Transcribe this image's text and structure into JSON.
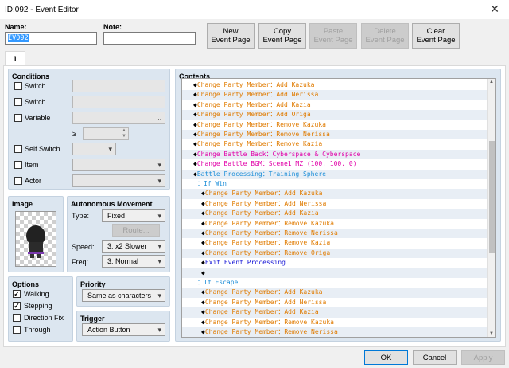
{
  "window": {
    "title": "ID:092 - Event Editor",
    "close_glyph": "✕"
  },
  "header": {
    "name_label": "Name:",
    "name_value": "EV092",
    "note_label": "Note:",
    "note_value": "",
    "buttons": {
      "new": "New\nEvent Page",
      "copy": "Copy\nEvent Page",
      "paste": "Paste\nEvent Page",
      "delete": "Delete\nEvent Page",
      "clear": "Clear\nEvent Page"
    }
  },
  "tabs": [
    "1"
  ],
  "conditions": {
    "title": "Conditions",
    "switch1": "Switch",
    "switch2": "Switch",
    "variable": "Variable",
    "ge": "≥",
    "self_switch": "Self Switch",
    "item": "Item",
    "actor": "Actor",
    "ellipsis": "..."
  },
  "image": {
    "title": "Image"
  },
  "autonomous": {
    "title": "Autonomous Movement",
    "type_label": "Type:",
    "type_value": "Fixed",
    "route_label": "Route...",
    "speed_label": "Speed:",
    "speed_value": "3: x2 Slower",
    "freq_label": "Freq:",
    "freq_value": "3: Normal"
  },
  "options": {
    "title": "Options",
    "walking": "Walking",
    "walking_checked": true,
    "stepping": "Stepping",
    "stepping_checked": true,
    "direction_fix": "Direction Fix",
    "direction_fix_checked": false,
    "through": "Through",
    "through_checked": false
  },
  "priority": {
    "title": "Priority",
    "value": "Same as characters"
  },
  "trigger": {
    "title": "Trigger",
    "value": "Action Button"
  },
  "contents": {
    "title": "Contents",
    "rows": [
      {
        "indent": 0,
        "marker": "◆",
        "text": "Change Party Member：Add Kazuka",
        "color": "or"
      },
      {
        "indent": 0,
        "marker": "◆",
        "text": "Change Party Member：Add Nerissa",
        "color": "or"
      },
      {
        "indent": 0,
        "marker": "◆",
        "text": "Change Party Member：Add Kazia",
        "color": "or"
      },
      {
        "indent": 0,
        "marker": "◆",
        "text": "Change Party Member：Add Origa",
        "color": "or"
      },
      {
        "indent": 0,
        "marker": "◆",
        "text": "Change Party Member：Remove Kazuka",
        "color": "or"
      },
      {
        "indent": 0,
        "marker": "◆",
        "text": "Change Party Member：Remove Nerissa",
        "color": "or"
      },
      {
        "indent": 0,
        "marker": "◆",
        "text": "Change Party Member：Remove Kazia",
        "color": "or"
      },
      {
        "indent": 0,
        "marker": "◆",
        "text": "Change Battle Back：Cyberspace & Cyberspace",
        "color": "mg"
      },
      {
        "indent": 0,
        "marker": "◆",
        "text": "Change Battle BGM：Scene1 MZ (100, 100, 0)",
        "color": "mg"
      },
      {
        "indent": 0,
        "marker": "◆",
        "text": "Battle Processing：Training Sphere",
        "color": "bl"
      },
      {
        "indent": 1,
        "marker": "：",
        "text": "If Win",
        "color": "bl"
      },
      {
        "indent": 2,
        "marker": "◆",
        "text": "Change Party Member：Add Kazuka",
        "color": "or"
      },
      {
        "indent": 2,
        "marker": "◆",
        "text": "Change Party Member：Add Nerissa",
        "color": "or"
      },
      {
        "indent": 2,
        "marker": "◆",
        "text": "Change Party Member：Add Kazia",
        "color": "or"
      },
      {
        "indent": 2,
        "marker": "◆",
        "text": "Change Party Member：Remove Kazuka",
        "color": "or"
      },
      {
        "indent": 2,
        "marker": "◆",
        "text": "Change Party Member：Remove Nerissa",
        "color": "or"
      },
      {
        "indent": 2,
        "marker": "◆",
        "text": "Change Party Member：Remove Kazia",
        "color": "or"
      },
      {
        "indent": 2,
        "marker": "◆",
        "text": "Change Party Member：Remove Origa",
        "color": "or"
      },
      {
        "indent": 2,
        "marker": "◆",
        "text": "Exit Event Processing",
        "color": "dk"
      },
      {
        "indent": 2,
        "marker": "◆",
        "text": "",
        "color": "or"
      },
      {
        "indent": 1,
        "marker": "：",
        "text": "If Escape",
        "color": "bl"
      },
      {
        "indent": 2,
        "marker": "◆",
        "text": "Change Party Member：Add Kazuka",
        "color": "or"
      },
      {
        "indent": 2,
        "marker": "◆",
        "text": "Change Party Member：Add Nerissa",
        "color": "or"
      },
      {
        "indent": 2,
        "marker": "◆",
        "text": "Change Party Member：Add Kazia",
        "color": "or"
      },
      {
        "indent": 2,
        "marker": "◆",
        "text": "Change Party Member：Remove Kazuka",
        "color": "or"
      },
      {
        "indent": 2,
        "marker": "◆",
        "text": "Change Party Member：Remove Nerissa",
        "color": "or"
      }
    ]
  },
  "footer": {
    "ok": "OK",
    "cancel": "Cancel",
    "apply": "Apply"
  }
}
